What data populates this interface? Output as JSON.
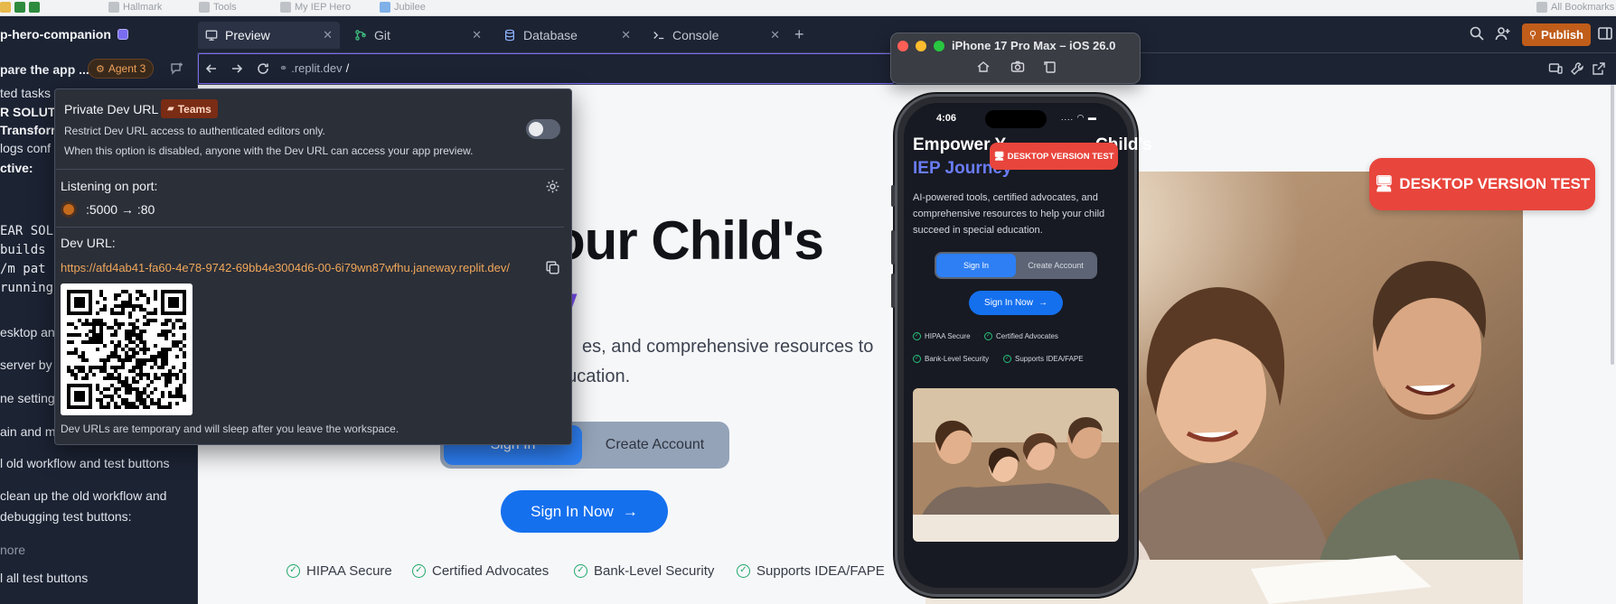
{
  "bookmarks": [
    "Hallmark",
    "Tools",
    "My IEP Hero",
    "Jubilee",
    "All Bookmarks"
  ],
  "appbar": {
    "project_name": "p-hero-companion",
    "tabs": [
      {
        "label": "Preview",
        "icon": "monitor-icon",
        "active": true
      },
      {
        "label": "Git",
        "icon": "git-branch-icon",
        "active": false
      },
      {
        "label": "Database",
        "icon": "database-icon",
        "active": false
      },
      {
        "label": "Console",
        "icon": "terminal-icon",
        "active": false
      }
    ],
    "add_tab": "+",
    "publish_label": "Publish"
  },
  "left_panel": {
    "title": "pare the app ...",
    "agent_label": "Agent 3",
    "lines": [
      {
        "text": "ted tasks",
        "style": "normal"
      },
      {
        "text": "R SOLUTI",
        "style": "bold"
      },
      {
        "text": "Transforn",
        "style": "bold"
      },
      {
        "text": "logs conf",
        "style": "normal"
      },
      {
        "text": "ctive:",
        "style": "bold"
      },
      {
        "text": "EAR SOLU",
        "style": "mono"
      },
      {
        "text": "builds -",
        "style": "mono"
      },
      {
        "text": " /m pat",
        "style": "mono"
      },
      {
        "text": "running",
        "style": "mono"
      },
      {
        "text": "esktop an",
        "style": "normal"
      },
      {
        "text": "server by",
        "style": "normal"
      },
      {
        "text": "ne setting",
        "style": "normal"
      },
      {
        "text": "ain and m",
        "style": "normal"
      },
      {
        "text": "l old workflow and test buttons",
        "style": "normal"
      },
      {
        "text": "clean up the old workflow and",
        "style": "normal"
      },
      {
        "text": "debugging test buttons:",
        "style": "normal"
      },
      {
        "text": "nore",
        "style": "muted"
      },
      {
        "text": "l all test buttons",
        "style": "normal"
      }
    ]
  },
  "urlbar": {
    "url_prefix": ".replit.dev",
    "url_suffix": "/"
  },
  "simulator": {
    "title": "iPhone 17 Pro Max – iOS 26.0"
  },
  "page": {
    "hero_title": "our Child's",
    "hero_accent": "y",
    "hero_sub1": "es, and comprehensive resources to",
    "hero_sub2": "ducation.",
    "signin_tab": "Sign In",
    "create_tab": "Create Account",
    "signin_now": "Sign In Now",
    "features": [
      "HIPAA Secure",
      "Certified Advocates",
      "Bank-Level Security",
      "Supports IDEA/FAPE"
    ],
    "desktop_badge": "DESKTOP VERSION TEST"
  },
  "phone": {
    "time": "4:06",
    "status": "....",
    "title": "Empower Y",
    "title_tail": "Child's",
    "accent": "IEP Journey",
    "badge": "DESKTOP VERSION TEST",
    "desc": "AI-powered tools, certified advocates, and comprehensive resources to help your child succeed in special education.",
    "signin_tab": "Sign In",
    "create_tab": "Create Account",
    "signin_now": "Sign In Now",
    "features": [
      "HIPAA Secure",
      "Certified Advocates",
      "Bank-Level Security",
      "Supports IDEA/FAPE"
    ]
  },
  "popover": {
    "title": "Private Dev URL",
    "teams_label": "Teams",
    "desc1": "Restrict Dev URL access to authenticated editors only.",
    "desc2": "When this option is disabled, anyone with the Dev URL can access your app preview.",
    "toggle_on": false,
    "port_label": "Listening on port:",
    "port_value": ":5000 → :80",
    "devurl_label": "Dev URL:",
    "devurl": "https://afd4ab41-fa60-4e78-9742-69bb4e3004d6-00-6i79wn87wfhu.janeway.replit.dev/",
    "footer": "Dev URLs are temporary and will sleep after you leave the workspace."
  },
  "colors": {
    "ide_bg": "#1c2333",
    "accent_orange": "#c05d1a",
    "primary_blue": "#1570ee",
    "badge_red": "#e8453c",
    "accent_purple": "#7a4df5"
  }
}
